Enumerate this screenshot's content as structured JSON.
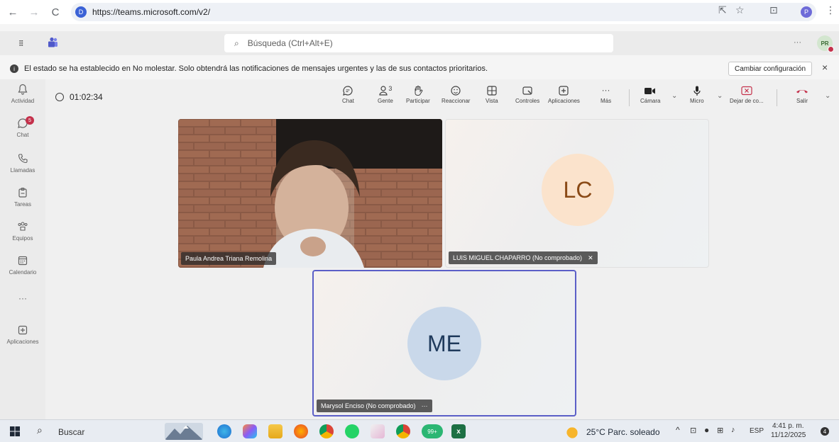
{
  "browser": {
    "url": "https://teams.microsoft.com/v2/",
    "back_icon": "←",
    "forward_icon": "→",
    "reload_icon": "C",
    "site_icon": "D",
    "cast_icon": "⇱",
    "star_icon": "☆",
    "ext_icon": "⊡",
    "profile": "P",
    "menu_icon": "⋮"
  },
  "teams_bar": {
    "grid_icon": "⁝⁝⁝",
    "search_placeholder": "Búsqueda (Ctrl+Alt+E)",
    "more": "···",
    "avatar": "PR"
  },
  "notification": {
    "text": "El estado se ha establecido en No molestar. Solo obtendrá las notificaciones de mensajes urgentes y las de sus contactos prioritarios.",
    "button": "Cambiar configuración",
    "close": "×"
  },
  "rail": {
    "items": [
      {
        "label": "Actividad",
        "icon": "bell-icon"
      },
      {
        "label": "Chat",
        "icon": "chat-icon",
        "badge": "5"
      },
      {
        "label": "Llamadas",
        "icon": "phone-icon"
      },
      {
        "label": "Tareas",
        "icon": "tasks-icon"
      },
      {
        "label": "Equipos",
        "icon": "teams-icon"
      },
      {
        "label": "Calendario",
        "icon": "calendar-icon"
      },
      {
        "label": "···",
        "icon": "more-icon"
      },
      {
        "label": "Aplicaciones",
        "icon": "apps-icon"
      }
    ]
  },
  "meeting": {
    "timer": "01:02:34",
    "tools": {
      "chat": "Chat",
      "people": "Gente",
      "people_count": "3",
      "raise": "Participar",
      "react": "Reaccionar",
      "view": "Vista",
      "controls": "Controles",
      "apps": "Aplicaciones",
      "more": "Más",
      "camera": "Cámara",
      "mic": "Micro",
      "share": "Dejar de co...",
      "leave": "Salir"
    },
    "participants": [
      {
        "name": "Paula Andrea Triana Remolina"
      },
      {
        "name": "LUIS MIGUEL CHAPARRO (No comprobado)",
        "initials": "LC"
      },
      {
        "name": "Marysol Enciso (No comprobado)",
        "initials": "ME",
        "more": "···"
      }
    ]
  },
  "taskbar": {
    "search": "Buscar",
    "weather": "25°C  Parc. soleado",
    "lang": "ESP",
    "time": "4:41 p. m.",
    "date": "11/12/2025",
    "notif_count": "4",
    "mail_count": "99+"
  },
  "colors": {
    "accent": "#5b5fc7",
    "leave_red": "#c4314b",
    "lc_circle": "#fbe0c4",
    "me_circle": "#c8d6e8"
  }
}
